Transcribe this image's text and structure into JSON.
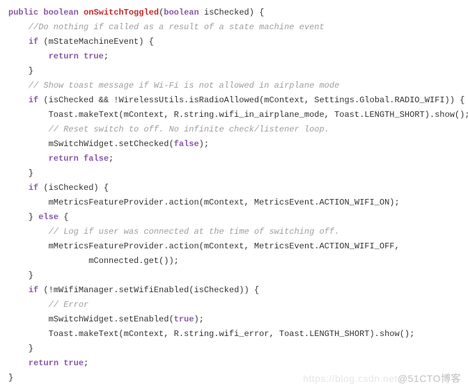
{
  "code": {
    "l1_kw1": "public",
    "l1_sp1": " ",
    "l1_kw2": "boolean",
    "l1_sp2": " ",
    "l1_method": "onSwitchToggled",
    "l1_txt": "(",
    "l1_kw3": "boolean",
    "l1_tail": " isChecked) {",
    "l2_comment": "    //Do nothing if called as a result of a state machine event",
    "l3_indent": "    ",
    "l3_kw": "if",
    "l3_txt": " (mStateMachineEvent) {",
    "l4_indent": "        ",
    "l4_kw1": "return",
    "l4_sp": " ",
    "l4_kw2": "true",
    "l4_txt": ";",
    "l5_txt": "    }",
    "l6_comment": "    // Show toast message if Wi-Fi is not allowed in airplane mode",
    "l7_indent": "    ",
    "l7_kw": "if",
    "l7_txt": " (isChecked && !WirelessUtils.isRadioAllowed(mContext, Settings.Global.RADIO_WIFI)) {",
    "l8_txt": "        Toast.makeText(mContext, R.string.wifi_in_airplane_mode, Toast.LENGTH_SHORT).show();",
    "l9_comment": "        // Reset switch to off. No infinite check/listener loop.",
    "l10_txt1": "        mSwitchWidget.setChecked(",
    "l10_kw": "false",
    "l10_txt2": ");",
    "l11_indent": "        ",
    "l11_kw1": "return",
    "l11_sp": " ",
    "l11_kw2": "false",
    "l11_txt": ";",
    "l12_txt": "    }",
    "blank": "",
    "l14_indent": "    ",
    "l14_kw": "if",
    "l14_txt": " (isChecked) {",
    "l15_txt": "        mMetricsFeatureProvider.action(mContext, MetricsEvent.ACTION_WIFI_ON);",
    "l16_txt1": "    } ",
    "l16_kw": "else",
    "l16_txt2": " {",
    "l17_comment": "        // Log if user was connected at the time of switching off.",
    "l18_txt": "        mMetricsFeatureProvider.action(mContext, MetricsEvent.ACTION_WIFI_OFF,",
    "l19_txt": "                mConnected.get());",
    "l20_txt": "    }",
    "l21_indent": "    ",
    "l21_kw": "if",
    "l21_txt": " (!mWifiManager.setWifiEnabled(isChecked)) {",
    "l22_comment": "        // Error",
    "l23_txt1": "        mSwitchWidget.setEnabled(",
    "l23_kw": "true",
    "l23_txt2": ");",
    "l24_txt": "        Toast.makeText(mContext, R.string.wifi_error, Toast.LENGTH_SHORT).show();",
    "l25_txt": "    }",
    "l26_indent": "    ",
    "l26_kw1": "return",
    "l26_sp": " ",
    "l26_kw2": "true",
    "l26_txt": ";",
    "l27_txt": "}"
  },
  "watermark": {
    "faint": "https://blog.csdn.net",
    "main": "@51CTO博客"
  }
}
